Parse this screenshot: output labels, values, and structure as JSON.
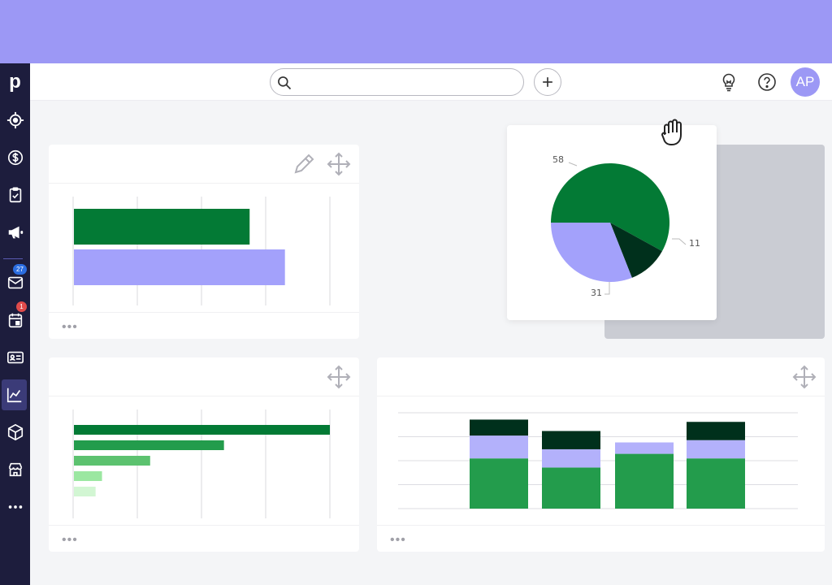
{
  "app": {
    "logo_text": "p",
    "banner_color": "#9c98f5"
  },
  "sidebar": {
    "items": [
      {
        "icon": "target-icon"
      },
      {
        "icon": "dollar-icon"
      },
      {
        "icon": "clipboard-check-icon"
      },
      {
        "icon": "megaphone-icon"
      },
      {
        "icon": "mail-icon",
        "badge": "27"
      },
      {
        "icon": "calendar-icon",
        "badge": "1"
      },
      {
        "icon": "contact-card-icon"
      },
      {
        "icon": "chart-icon",
        "active": true
      },
      {
        "icon": "box-icon"
      },
      {
        "icon": "store-icon"
      },
      {
        "icon": "more-icon"
      }
    ]
  },
  "topbar": {
    "search_placeholder": "",
    "add_icon": "plus-icon",
    "tips_icon": "lightbulb-icon",
    "help_icon": "help-icon",
    "avatar_initials": "AP"
  },
  "colors": {
    "dark_green": "#037a35",
    "darkest_green": "#00301c",
    "medium_green": "#239c4c",
    "lavender": "#a3a1fb",
    "light_green": "#5cc26f",
    "pale_green": "#9be7a1",
    "paler_green": "#d2f6d3"
  },
  "cards": {
    "footer_dots": "•••"
  },
  "chart_data": [
    {
      "type": "bar",
      "orientation": "horizontal",
      "values": [
        55,
        66
      ],
      "xlim": [
        0,
        80
      ],
      "grid": true,
      "colors": [
        "#037a35",
        "#a3a1fb"
      ]
    },
    {
      "type": "pie",
      "slices": [
        {
          "label": "58",
          "value": 58,
          "color": "#037a35"
        },
        {
          "label": "11",
          "value": 11,
          "color": "#00301c"
        },
        {
          "label": "31",
          "value": 31,
          "color": "#a3a1fb"
        }
      ]
    },
    {
      "type": "bar",
      "orientation": "horizontal",
      "values": [
        80,
        47,
        24,
        9,
        7
      ],
      "xlim": [
        0,
        80
      ],
      "grid": true,
      "colors": [
        "#037a35",
        "#239c4c",
        "#5cc26f",
        "#9be7a1",
        "#d2f6d3"
      ]
    },
    {
      "type": "bar",
      "stacked": true,
      "categories": [
        "",
        "",
        "",
        ""
      ],
      "series": [
        {
          "values": [
            22,
            18,
            24,
            22
          ],
          "color": "#239c4c"
        },
        {
          "values": [
            10,
            8,
            5,
            8
          ],
          "color": "#b3b1fb"
        },
        {
          "values": [
            7,
            8,
            0,
            8
          ],
          "color": "#00301c"
        }
      ],
      "ylim": [
        0,
        42
      ],
      "grid": true
    }
  ]
}
